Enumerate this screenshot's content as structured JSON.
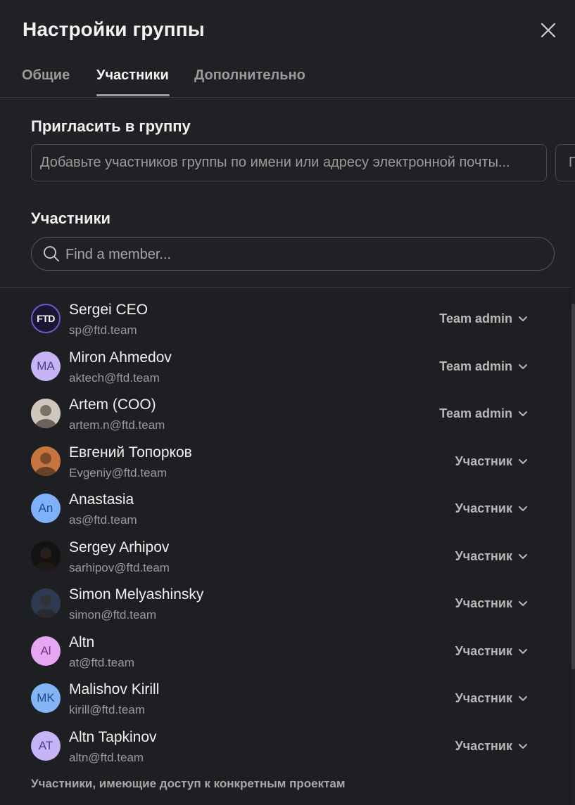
{
  "dialog": {
    "title": "Настройки группы"
  },
  "tabs": [
    {
      "label": "Общие",
      "active": false
    },
    {
      "label": "Участники",
      "active": true
    },
    {
      "label": "Дополнительно",
      "active": false
    }
  ],
  "invite": {
    "title": "Пригласить в группу",
    "placeholder": "Добавьте участников группы по имени или адресу электронной почты...",
    "button_label": "П"
  },
  "members_section": {
    "title": "Участники",
    "search_placeholder": "Find a member..."
  },
  "members": [
    {
      "name": "Sergei CEO",
      "email": "sp@ftd.team",
      "role": "Team admin",
      "avatar": {
        "type": "logo",
        "text": "FTD",
        "bg": "#1a1633"
      }
    },
    {
      "name": "Miron Ahmedov",
      "email": "aktech@ftd.team",
      "role": "Team admin",
      "avatar": {
        "type": "initials",
        "text": "MA",
        "bg": "#c7b4f7",
        "fg": "#4b3b8c"
      }
    },
    {
      "name": "Artem (COO)",
      "email": "artem.n@ftd.team",
      "role": "Team admin",
      "avatar": {
        "type": "photo",
        "bg": "#cfc7bd"
      }
    },
    {
      "name": "Евгений Топорков",
      "email": "Evgeniy@ftd.team",
      "role": "Участник",
      "avatar": {
        "type": "photo",
        "bg": "#c7753e"
      }
    },
    {
      "name": "Anastasia",
      "email": "as@ftd.team",
      "role": "Участник",
      "avatar": {
        "type": "initials",
        "text": "An",
        "bg": "#7fb1fa",
        "fg": "#1f4a8c"
      }
    },
    {
      "name": "Sergey Arhipov",
      "email": "sarhipov@ftd.team",
      "role": "Участник",
      "avatar": {
        "type": "photo",
        "bg": "#121212"
      }
    },
    {
      "name": "Simon Melyashinsky",
      "email": "simon@ftd.team",
      "role": "Участник",
      "avatar": {
        "type": "photo",
        "bg": "#2c3a52"
      }
    },
    {
      "name": "Altn",
      "email": "at@ftd.team",
      "role": "Участник",
      "avatar": {
        "type": "initials",
        "text": "Al",
        "bg": "#e7a6f2",
        "fg": "#7a2f8a"
      }
    },
    {
      "name": "Malishov Kirill",
      "email": "kirill@ftd.team",
      "role": "Участник",
      "avatar": {
        "type": "initials",
        "text": "MK",
        "bg": "#84b5f7",
        "fg": "#1f4a8c"
      }
    },
    {
      "name": "Altn Tapkinov",
      "email": "altn@ftd.team",
      "role": "Участник",
      "avatar": {
        "type": "initials",
        "text": "AT",
        "bg": "#c7b4f7",
        "fg": "#4b3b8c"
      }
    }
  ],
  "footer": {
    "note": "Участники, имеющие доступ к конкретным проектам"
  },
  "colors": {
    "background": "#202124",
    "list_background": "#1e1f22",
    "border": "#4a4b4f",
    "text": "#f0f0f0",
    "muted": "#9a9a9a"
  }
}
